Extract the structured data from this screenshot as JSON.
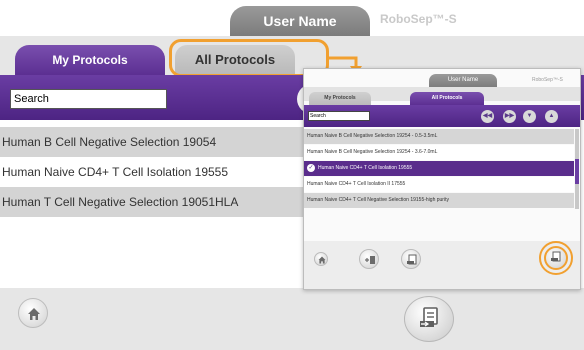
{
  "header": {
    "user_name": "User Name",
    "brand": "RoboSep™-S"
  },
  "tabs": {
    "my_protocols": "My Protocols",
    "all_protocols": "All Protocols"
  },
  "search": {
    "label": "Search"
  },
  "protocols": [
    "Human B Cell Negative Selection 19054",
    "Human Naive CD4+ T Cell Isolation 19555",
    "Human T Cell Negative Selection 19051HLA"
  ],
  "inset": {
    "header": {
      "user_name": "User Name",
      "brand": "RoboSep™-S"
    },
    "tabs": {
      "my_protocols": "My Protocols",
      "all_protocols": "All Protocols"
    },
    "search": "Search",
    "protocols": [
      "Human Naive B Cell Negative Selection 19254 - 0.5-3.5mL",
      "Human Naive B Cell Negative Selection 19254 - 3.6-7.0mL",
      "Human Naive CD4+ T Cell Isolation 19555",
      "Human Naive CD4+ T Cell Isolation II 17555",
      "Human Naive CD4+ T Cell Negative Selection 19155-high purity"
    ],
    "selected_index": 2
  },
  "colors": {
    "purple": "#5c2f92",
    "highlight": "#f1a030"
  },
  "icons": {
    "home": "home-icon",
    "export": "export-document-icon"
  }
}
